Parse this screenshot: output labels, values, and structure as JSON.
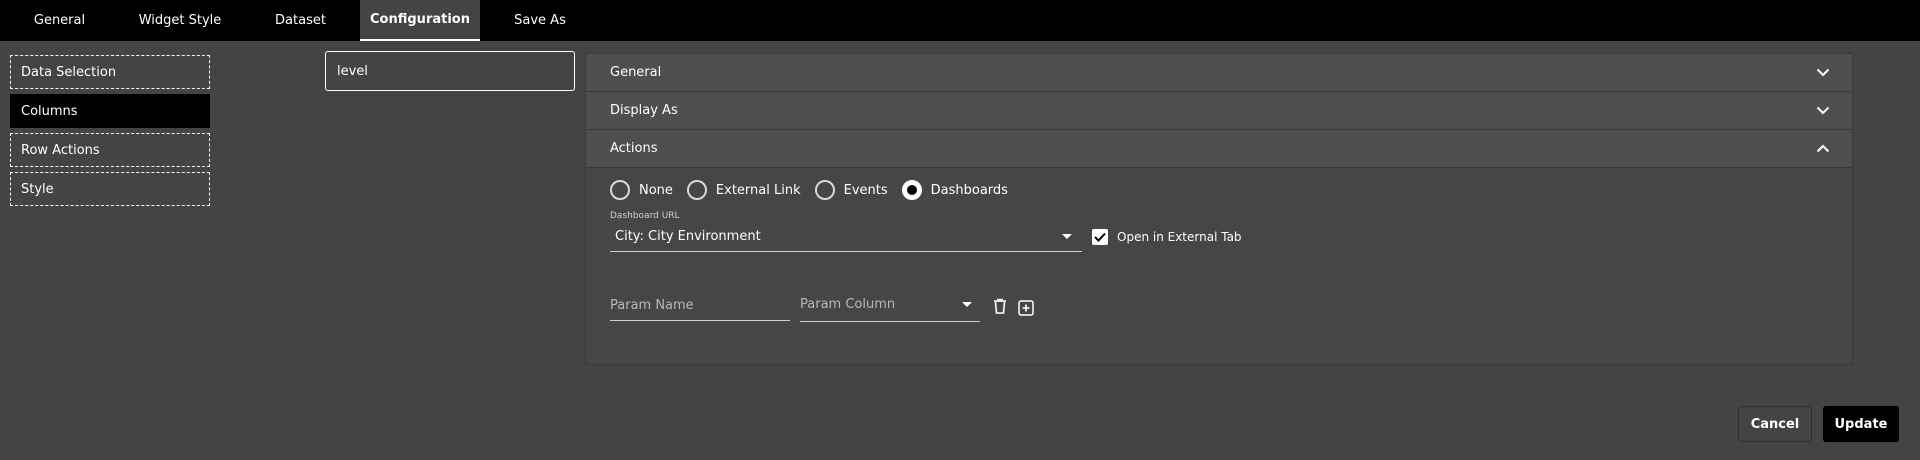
{
  "tabs": [
    {
      "label": "General",
      "active": false
    },
    {
      "label": "Widget Style",
      "active": false
    },
    {
      "label": "Dataset",
      "active": false
    },
    {
      "label": "Configuration",
      "active": true
    },
    {
      "label": "Save As",
      "active": false
    }
  ],
  "menu": {
    "items": [
      {
        "label": "Data Selection",
        "active": false
      },
      {
        "label": "Columns",
        "active": true
      },
      {
        "label": "Row Actions",
        "active": false
      },
      {
        "label": "Style",
        "active": false
      }
    ]
  },
  "columns": {
    "selected": "level"
  },
  "accordion": {
    "general": {
      "title": "General",
      "icon": "chevron-down-icon"
    },
    "display_as": {
      "title": "Display As",
      "icon": "chevron-down-icon"
    },
    "actions": {
      "title": "Actions",
      "icon": "chevron-up-icon",
      "options": [
        {
          "label": "None",
          "checked": false
        },
        {
          "label": "External Link",
          "checked": false
        },
        {
          "label": "Events",
          "checked": false
        },
        {
          "label": "Dashboards",
          "checked": true
        }
      ],
      "dashboard_url_label": "Dashboard URL",
      "dashboard_url_value": "City: City Environment",
      "open_external_label": "Open in External Tab",
      "open_external_checked": true,
      "param_name_placeholder": "Param Name",
      "param_column_placeholder": "Param Column"
    }
  },
  "footer": {
    "cancel_label": "Cancel",
    "update_label": "Update"
  },
  "colors": {
    "background": "#454346",
    "tabbar": "#000000",
    "accent": "#000000",
    "text": "#ffffff"
  }
}
